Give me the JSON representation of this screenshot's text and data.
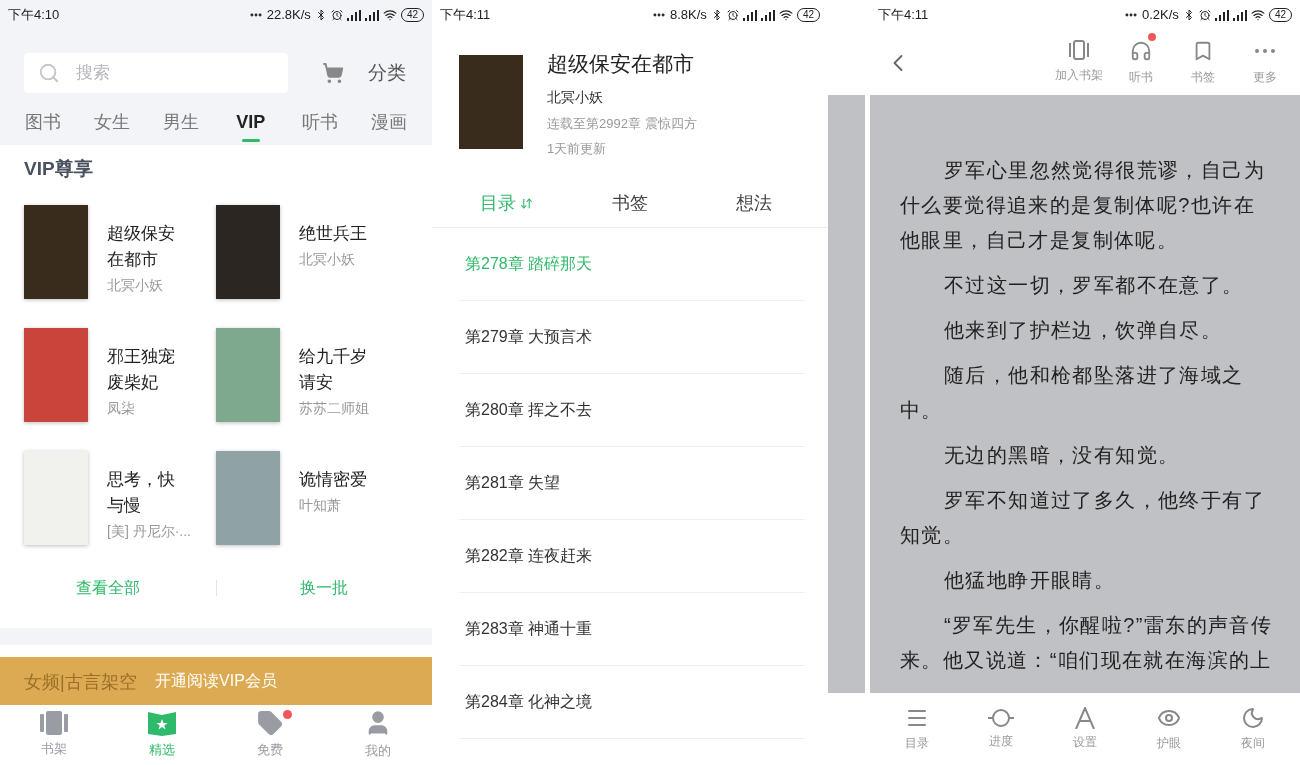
{
  "store_screen": {
    "status_bar": {
      "time": "下午4:10",
      "speed": "22.8K/s",
      "battery": "42"
    },
    "search": {
      "placeholder": "搜索"
    },
    "category_link": "分类",
    "tabs": [
      {
        "label": "图书",
        "selected": false
      },
      {
        "label": "女生",
        "selected": false
      },
      {
        "label": "男生",
        "selected": false
      },
      {
        "label": "VIP",
        "selected": true
      },
      {
        "label": "听书",
        "selected": false
      },
      {
        "label": "漫画",
        "selected": false
      }
    ],
    "section_title": "VIP尊享",
    "books": [
      {
        "title": "超级保安在都市",
        "author": "北冥小妖"
      },
      {
        "title": "绝世兵王",
        "author": "北冥小妖"
      },
      {
        "title": "邪王独宠废柴妃",
        "author": "凤柒"
      },
      {
        "title": "给九千岁请安",
        "author": "苏苏二师姐"
      },
      {
        "title": "思考，快与慢",
        "author": "[美] 丹尼尔·..."
      },
      {
        "title": "诡情密爱",
        "author": "叶知萧"
      }
    ],
    "actions": [
      "查看全部",
      "换一批"
    ],
    "banner": {
      "faded_text": "女频|古言架空",
      "label": "开通阅读VIP会员"
    },
    "bottom_nav": [
      {
        "kind": "shelf",
        "label": "书架",
        "selected": false,
        "badge": false
      },
      {
        "kind": "featured",
        "label": "精选",
        "selected": true,
        "badge": false
      },
      {
        "kind": "free",
        "label": "免费",
        "selected": false,
        "badge": true
      },
      {
        "kind": "me",
        "label": "我的",
        "selected": false,
        "badge": false
      }
    ]
  },
  "catalog_screen": {
    "status_bar": {
      "time": "下午4:11",
      "speed": "8.8K/s",
      "battery": "42"
    },
    "book": {
      "title": "超级保安在都市",
      "author": "北冥小妖",
      "progress": "连载至第2992章 震惊四方",
      "updated": "1天前更新"
    },
    "tabs": [
      {
        "label": "目录",
        "selected": true
      },
      {
        "label": "书签",
        "selected": false
      },
      {
        "label": "想法",
        "selected": false
      }
    ],
    "chapters": [
      {
        "title": "第278章 踏碎那天",
        "selected": true
      },
      {
        "title": "第279章 大预言术",
        "selected": false
      },
      {
        "title": "第280章 挥之不去",
        "selected": false
      },
      {
        "title": "第281章 失望",
        "selected": false
      },
      {
        "title": "第282章 连夜赶来",
        "selected": false
      },
      {
        "title": "第283章 神通十重",
        "selected": false
      },
      {
        "title": "第284章 化神之境",
        "selected": false
      }
    ]
  },
  "reader_screen": {
    "status_bar": {
      "time": "下午4:11",
      "speed": "0.2K/s",
      "battery": "42"
    },
    "toolbar": [
      {
        "kind": "shelf",
        "label": "加入书架",
        "badge": false
      },
      {
        "kind": "listen",
        "label": "听书",
        "badge": true
      },
      {
        "kind": "bookmark",
        "label": "书签",
        "badge": false
      },
      {
        "kind": "more",
        "label": "更多",
        "badge": false
      }
    ],
    "paragraphs": [
      "罗军心里忽然觉得很荒谬，自己为什么要觉得追来的是复制体呢?也许在他眼里，自己才是复制体呢。",
      "不过这一切，罗军都不在意了。",
      "他来到了护栏边，饮弹自尽。",
      "随后，他和枪都坠落进了海域之中。",
      "无边的黑暗，没有知觉。",
      "罗军不知道过了多久，他终于有了知觉。",
      "他猛地睁开眼睛。",
      "“罗军先生，你醒啦?”雷东的声音传来。他又说道：“咱们现在就在海滨的上"
    ],
    "bottom_bar": [
      {
        "kind": "contents",
        "label": "目录"
      },
      {
        "kind": "progress",
        "label": "进度"
      },
      {
        "kind": "settings",
        "label": "设置"
      },
      {
        "kind": "eye",
        "label": "护眼"
      },
      {
        "kind": "night",
        "label": "夜间"
      }
    ]
  }
}
